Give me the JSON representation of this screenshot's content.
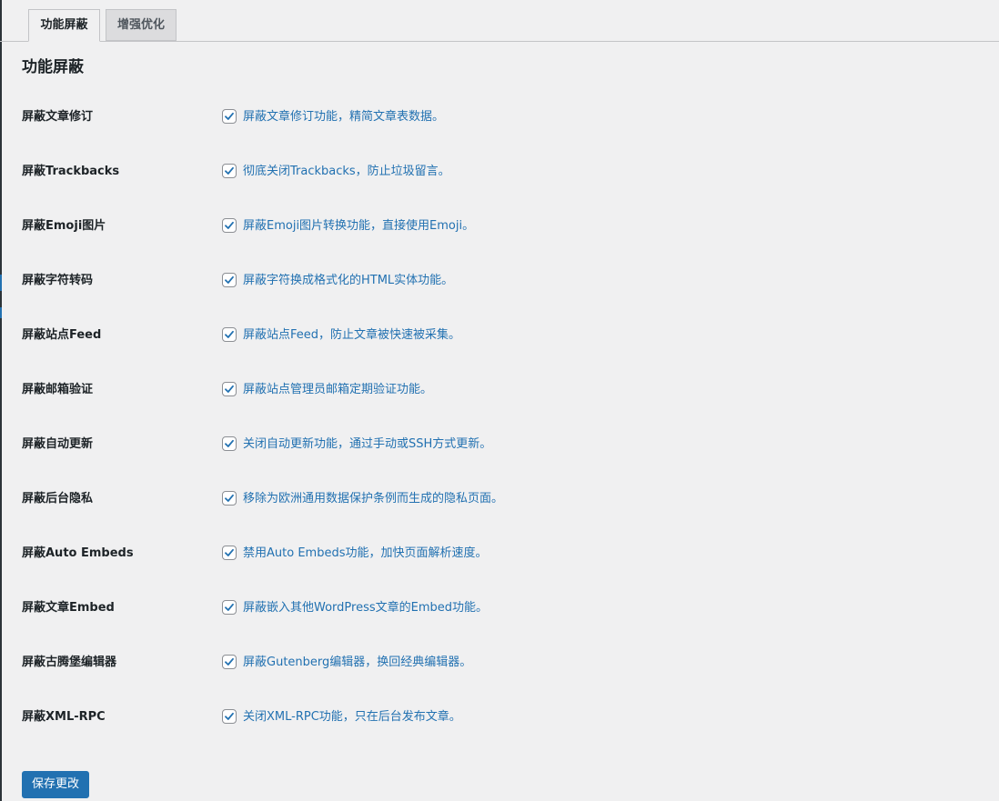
{
  "tabs": [
    {
      "label": "功能屏蔽",
      "active": true
    },
    {
      "label": "增强优化",
      "active": false
    }
  ],
  "section_title": "功能屏蔽",
  "settings": [
    {
      "label": "屏蔽文章修订",
      "description": "屏蔽文章修订功能，精简文章表数据。",
      "checked": true
    },
    {
      "label": "屏蔽Trackbacks",
      "description": "彻底关闭Trackbacks，防止垃圾留言。",
      "checked": true
    },
    {
      "label": "屏蔽Emoji图片",
      "description": "屏蔽Emoji图片转换功能，直接使用Emoji。",
      "checked": true
    },
    {
      "label": "屏蔽字符转码",
      "description": "屏蔽字符换成格式化的HTML实体功能。",
      "checked": true
    },
    {
      "label": "屏蔽站点Feed",
      "description": "屏蔽站点Feed，防止文章被快速被采集。",
      "checked": true
    },
    {
      "label": "屏蔽邮箱验证",
      "description": "屏蔽站点管理员邮箱定期验证功能。",
      "checked": true
    },
    {
      "label": "屏蔽自动更新",
      "description": "关闭自动更新功能，通过手动或SSH方式更新。",
      "checked": true
    },
    {
      "label": "屏蔽后台隐私",
      "description": "移除为欧洲通用数据保护条例而生成的隐私页面。",
      "checked": true
    },
    {
      "label": "屏蔽Auto Embeds",
      "description": "禁用Auto Embeds功能，加快页面解析速度。",
      "checked": true
    },
    {
      "label": "屏蔽文章Embed",
      "description": "屏蔽嵌入其他WordPress文章的Embed功能。",
      "checked": true
    },
    {
      "label": "屏蔽古腾堡编辑器",
      "description": "屏蔽Gutenberg编辑器，换回经典编辑器。",
      "checked": true
    },
    {
      "label": "屏蔽XML-RPC",
      "description": "关闭XML-RPC功能，只在后台发布文章。",
      "checked": true
    }
  ],
  "save_button_label": "保存更改",
  "colors": {
    "accent": "#2271b1",
    "background": "#f0f0f1",
    "text": "#1d2327"
  }
}
